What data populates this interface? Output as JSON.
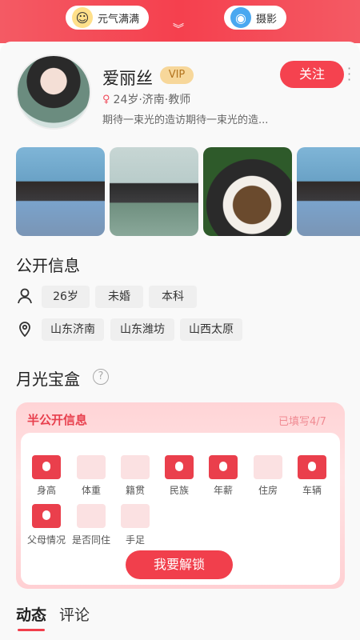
{
  "header": {
    "pill_left_label": "元气满满",
    "pill_left_icon": "emoji-icon",
    "pill_right_label": "摄影",
    "pill_right_icon": "camera-icon",
    "chevron": "︾"
  },
  "profile": {
    "name": "爱丽丝",
    "vip": "VIP",
    "meta": "24岁·济南·教师",
    "bio": "期待一束光的造访期待一束光的造...",
    "follow_label": "关注"
  },
  "public_info": {
    "title": "公开信息",
    "basic_chips": [
      "26岁",
      "未婚",
      "本科"
    ],
    "location_chips": [
      "山东济南",
      "山东潍坊",
      "山西太原"
    ]
  },
  "moon_box": {
    "title": "月光宝盒",
    "help": "?",
    "semi_public_title": "半公开信息",
    "filled_text": "已填写4/7",
    "items_row1": [
      {
        "label": "身高",
        "on": true
      },
      {
        "label": "体重",
        "on": false
      },
      {
        "label": "籍贯",
        "on": false
      },
      {
        "label": "民族",
        "on": true
      },
      {
        "label": "年薪",
        "on": true
      },
      {
        "label": "住房",
        "on": false
      },
      {
        "label": "车辆",
        "on": true
      }
    ],
    "items_row2": [
      {
        "label": "父母情况",
        "on": true
      },
      {
        "label": "是否同住",
        "on": false
      },
      {
        "label": "手足",
        "on": false
      }
    ],
    "unlock_label": "我要解锁"
  },
  "tabs": [
    "动态",
    "评论"
  ],
  "colors": {
    "accent": "#f13f4c",
    "vip_bg": "#f7d79a"
  }
}
